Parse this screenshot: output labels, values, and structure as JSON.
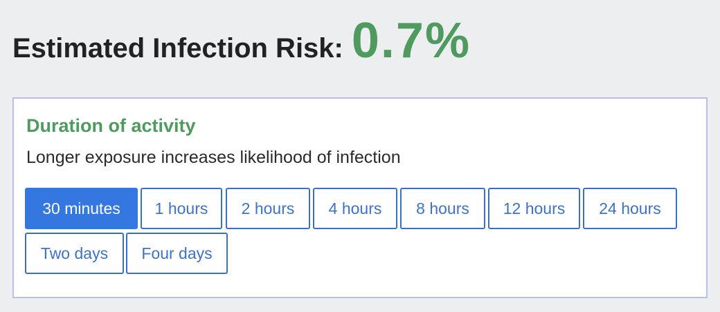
{
  "risk": {
    "label": "Estimated Infection Risk:",
    "value": "0.7%"
  },
  "duration": {
    "title": "Duration of activity",
    "description": "Longer exposure increases likelihood of infection",
    "options": [
      "30 minutes",
      "1 hours",
      "2 hours",
      "4 hours",
      "8 hours",
      "12 hours",
      "24 hours",
      "Two days",
      "Four days"
    ],
    "selected": "30 minutes"
  },
  "colors": {
    "accent_green": "#4f9a5e",
    "button_blue": "#3577e0",
    "panel_border": "#b9bdf2",
    "background": "#edeef0"
  }
}
